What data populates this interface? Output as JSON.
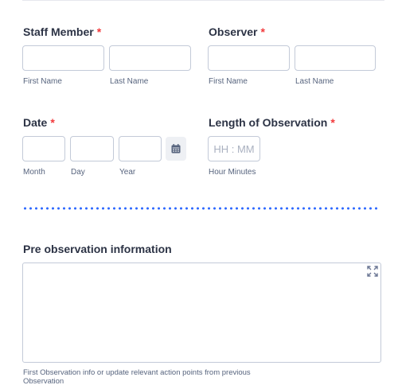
{
  "staff": {
    "label": "Staff Member",
    "required_mark": "*",
    "first_sublabel": "First Name",
    "last_sublabel": "Last Name"
  },
  "observer": {
    "label": "Observer",
    "required_mark": "*",
    "first_sublabel": "First Name",
    "last_sublabel": "Last Name"
  },
  "date": {
    "label": "Date",
    "required_mark": "*",
    "month_sublabel": "Month",
    "day_sublabel": "Day",
    "year_sublabel": "Year"
  },
  "length": {
    "label": "Length of Observation",
    "required_mark": "*",
    "placeholder": "HH : MM",
    "sublabel": "Hour Minutes"
  },
  "pre_obs": {
    "label": "Pre observation information",
    "help_text": "First Observation info or update relevant action points from previous Observation"
  },
  "colors": {
    "required": "#f23a3c",
    "divider": "#2e69ff",
    "border": "#c3cad8",
    "text": "#2c3345",
    "sublabel": "#57647e"
  },
  "icons": {
    "calendar": "calendar-icon",
    "expand": "expand-icon"
  }
}
